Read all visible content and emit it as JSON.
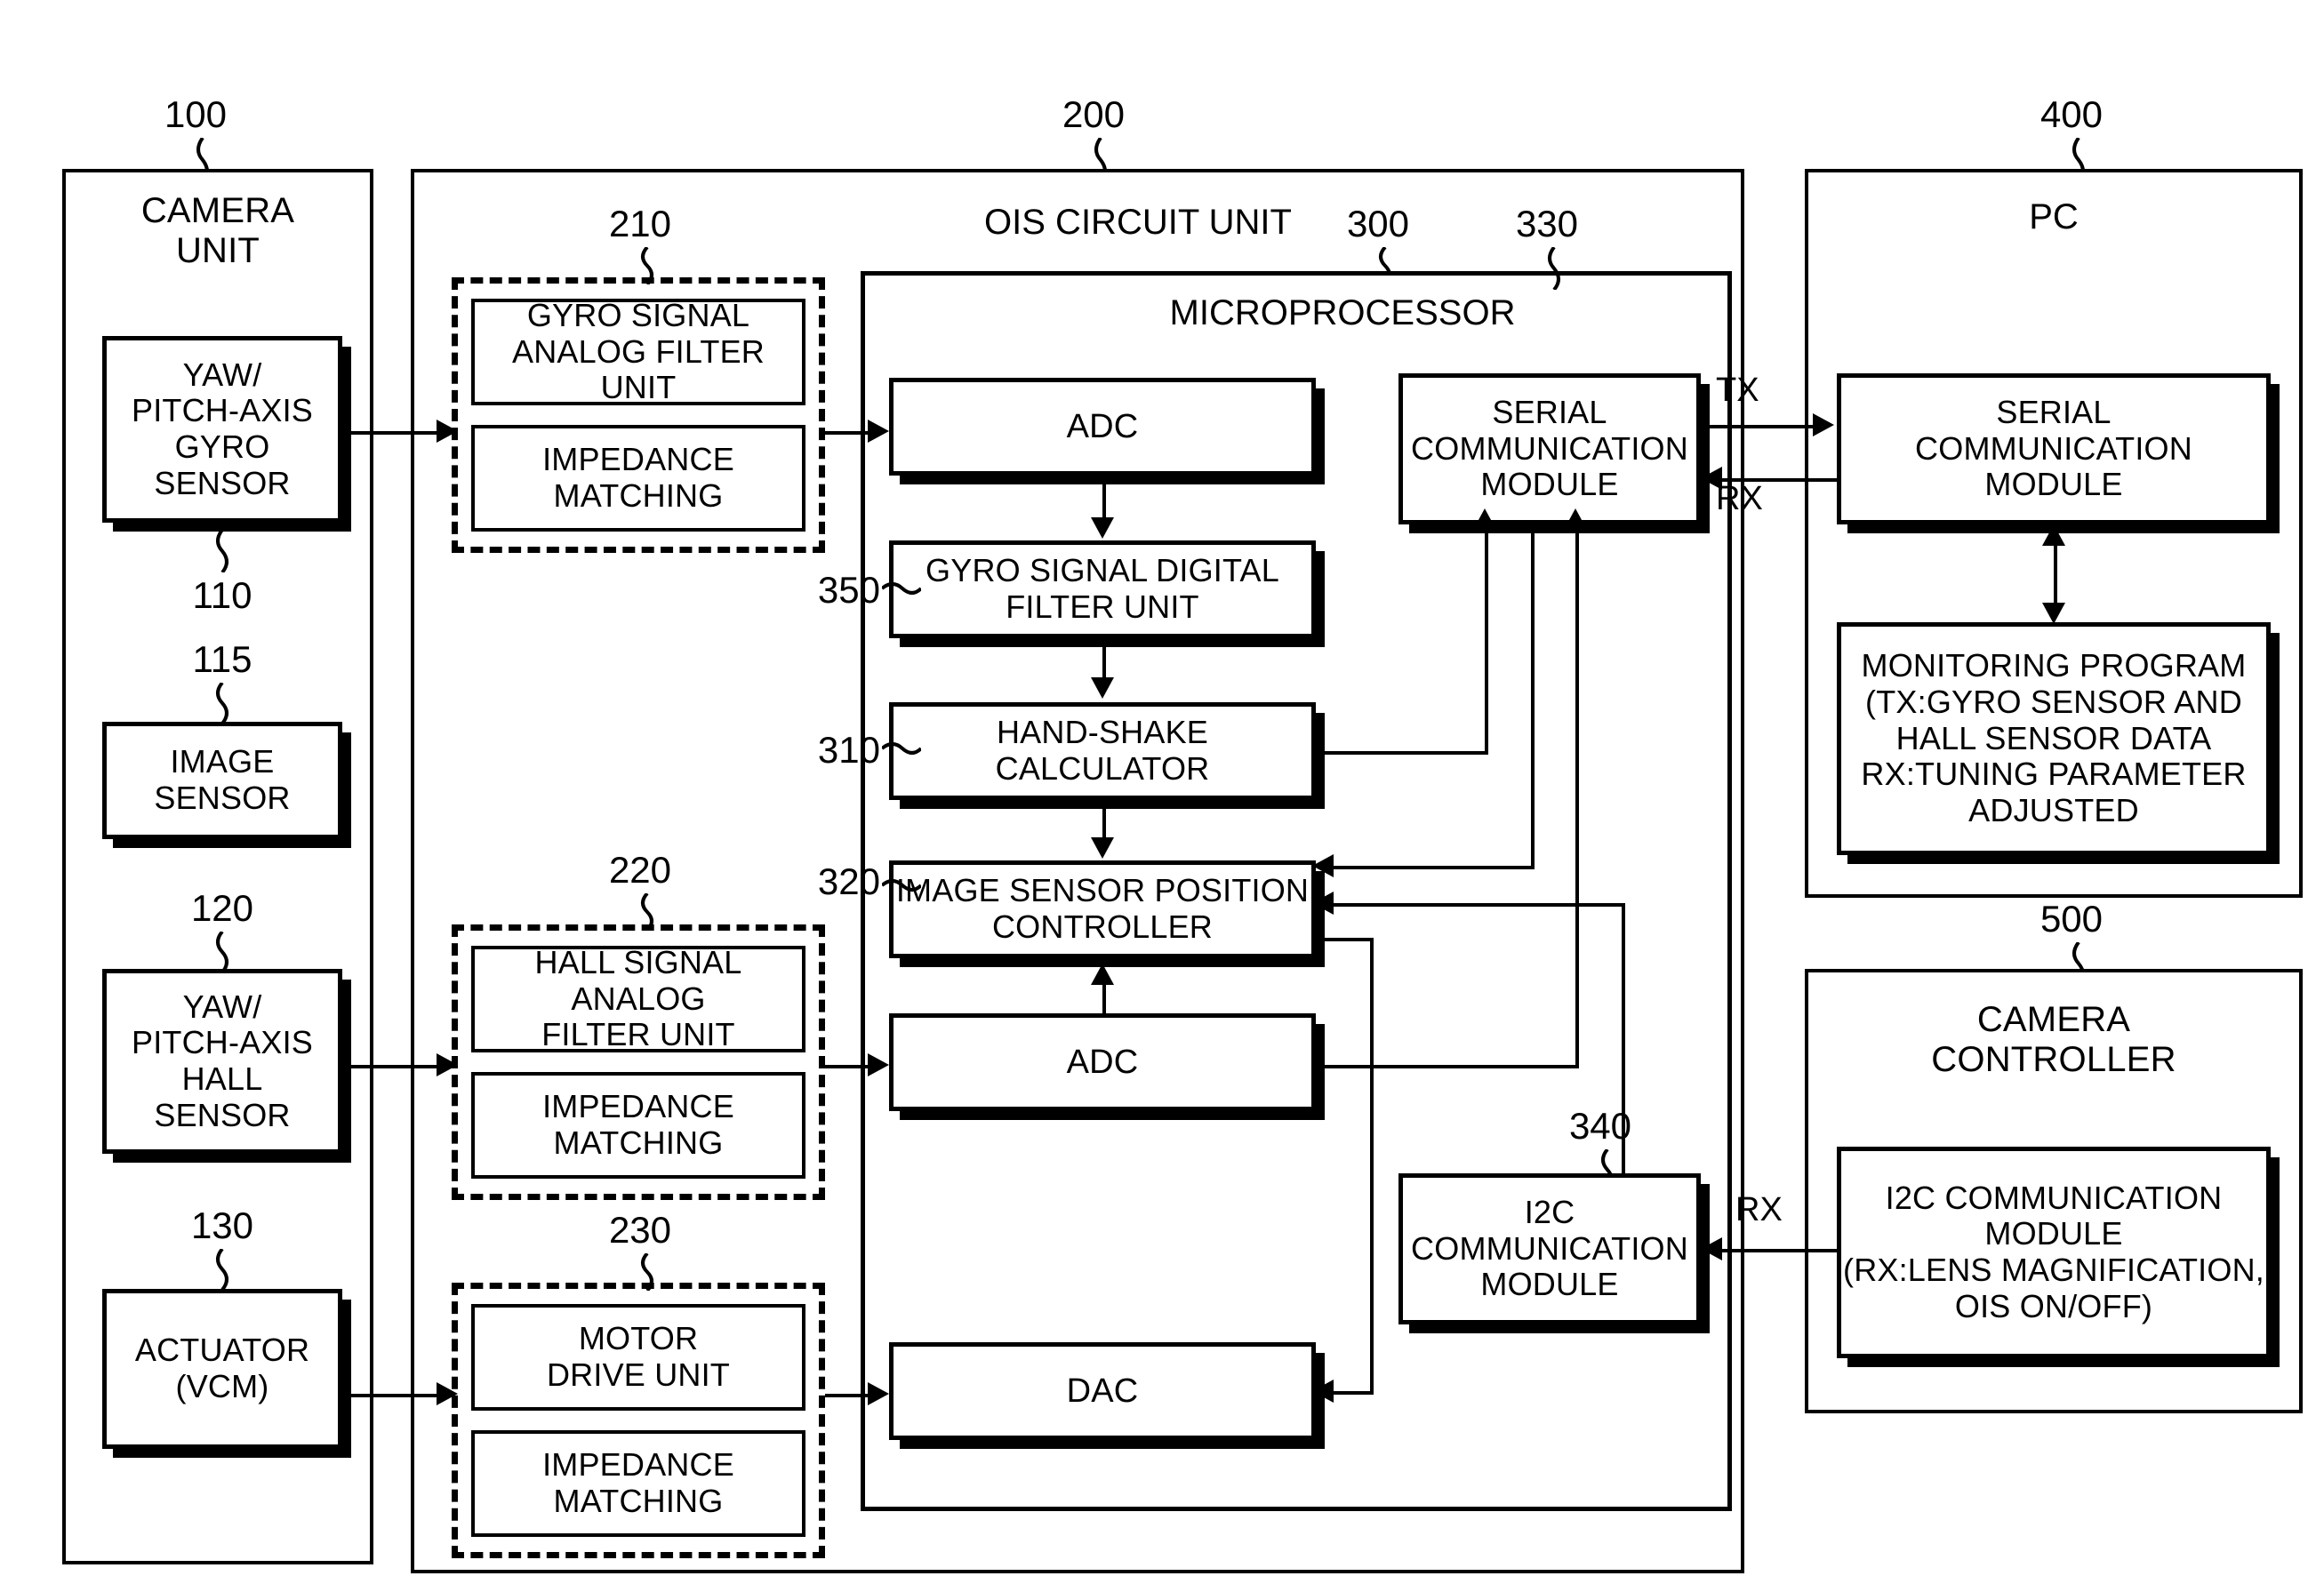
{
  "figure": {
    "type": "patent-block-diagram",
    "groups": {
      "camera_unit": {
        "ref": "100",
        "title": "CAMERA\nUNIT"
      },
      "ois_circuit_unit": {
        "ref": "200",
        "title": "OIS CIRCUIT UNIT"
      },
      "microprocessor": {
        "ref": "300",
        "title": "MICROPROCESSOR"
      },
      "pc": {
        "ref": "400",
        "title": "PC"
      },
      "camera_controller": {
        "ref": "500",
        "title": "CAMERA\nCONTROLLER"
      }
    },
    "blocks": {
      "gyro_sensor": {
        "ref": "110",
        "label": "YAW/\nPITCH-AXIS\nGYRO\nSENSOR"
      },
      "image_sensor": {
        "ref": "115",
        "label": "IMAGE\nSENSOR"
      },
      "hall_sensor": {
        "ref": "120",
        "label": "YAW/\nPITCH-AXIS\nHALL\nSENSOR"
      },
      "actuator": {
        "ref": "130",
        "label": "ACTUATOR\n(VCM)"
      },
      "gyro_analog_group": {
        "ref": "210"
      },
      "gyro_analog_filter": {
        "label": "GYRO SIGNAL\nANALOG FILTER UNIT"
      },
      "gyro_impedance": {
        "label": "IMPEDANCE\nMATCHING"
      },
      "hall_analog_group": {
        "ref": "220"
      },
      "hall_analog_filter": {
        "label": "HALL SIGNAL ANALOG\nFILTER UNIT"
      },
      "hall_impedance": {
        "label": "IMPEDANCE\nMATCHING"
      },
      "motor_group": {
        "ref": "230"
      },
      "motor_drive": {
        "label": "MOTOR\nDRIVE UNIT"
      },
      "motor_impedance": {
        "label": "IMPEDANCE\nMATCHING"
      },
      "adc_gyro": {
        "label": "ADC"
      },
      "gyro_digital_filter": {
        "ref": "350",
        "label": "GYRO SIGNAL DIGITAL\nFILTER UNIT"
      },
      "hand_shake_calculator": {
        "ref": "310",
        "label": "HAND-SHAKE\nCALCULATOR"
      },
      "image_sensor_position_controller": {
        "ref": "320",
        "label": "IMAGE SENSOR POSITION\nCONTROLLER"
      },
      "adc_hall": {
        "label": "ADC"
      },
      "dac": {
        "label": "DAC"
      },
      "serial_comm_mcu": {
        "ref": "330",
        "label": "SERIAL\nCOMMUNICATION\nMODULE"
      },
      "i2c_comm_mcu": {
        "ref": "340",
        "label": "I2C\nCOMMUNICATION\nMODULE"
      },
      "serial_comm_pc": {
        "label": "SERIAL\nCOMMUNICATION\nMODULE"
      },
      "monitoring_program": {
        "label": "MONITORING PROGRAM\n(TX:GYRO SENSOR AND\nHALL SENSOR DATA\nRX:TUNING PARAMETER\nADJUSTED"
      },
      "i2c_comm_controller": {
        "label": "I2C COMMUNICATION\nMODULE\n(RX:LENS MAGNIFICATION,\nOIS ON/OFF)"
      }
    },
    "signal_labels": {
      "tx": "TX",
      "rx": "RX",
      "rx_i2c": "RX"
    }
  }
}
